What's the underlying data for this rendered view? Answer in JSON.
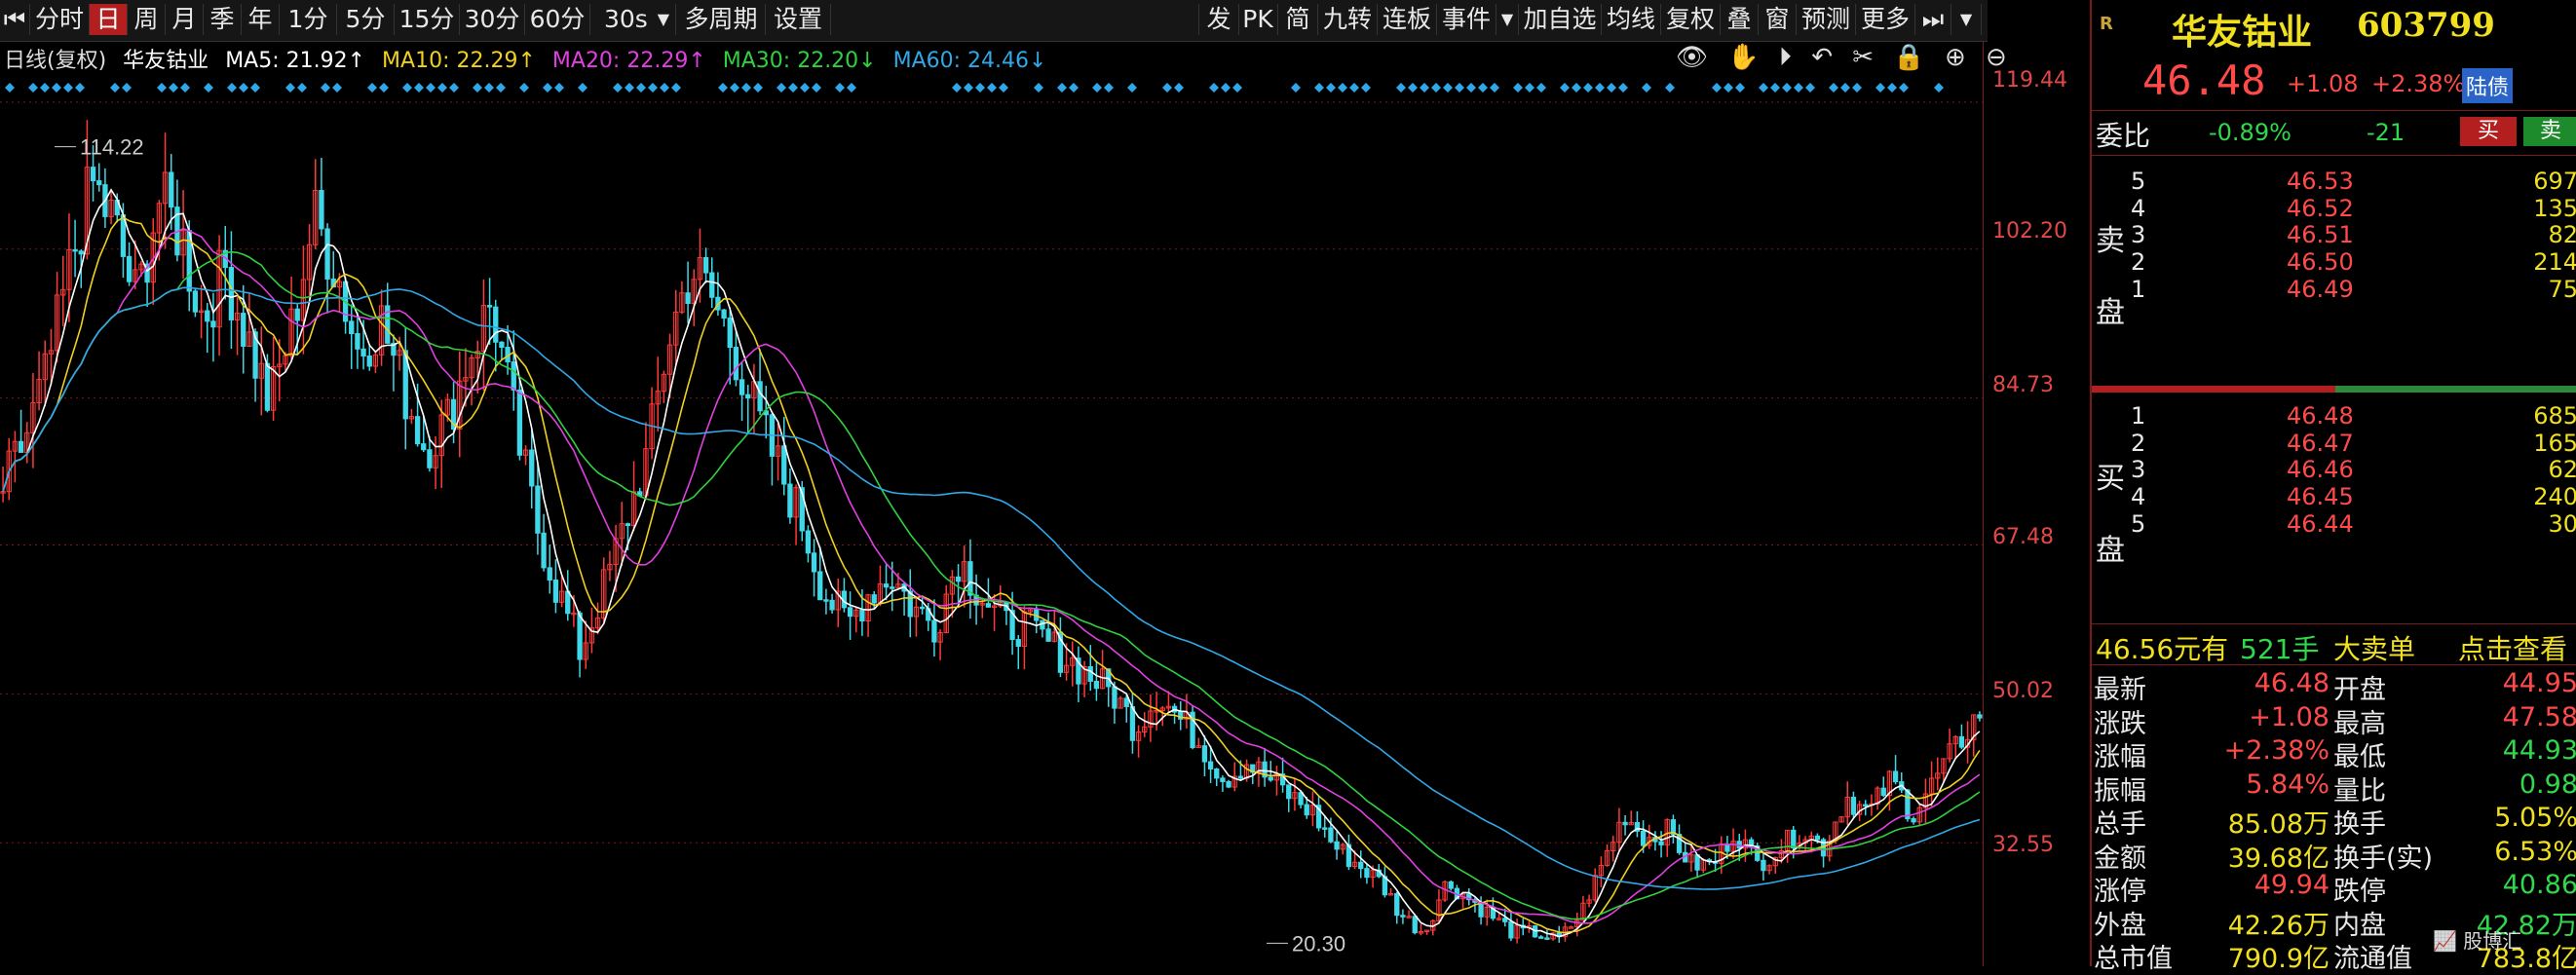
{
  "toolbar": {
    "left": [
      "分时",
      "日",
      "周",
      "月",
      "季",
      "年",
      "1分",
      "5分",
      "15分",
      "30分",
      "60分",
      "30s",
      "多周期",
      "设置"
    ],
    "right": [
      "发",
      "PK",
      "简",
      "九转",
      "连板",
      "事件",
      "加自选",
      "均线",
      "复权",
      "叠",
      "窗",
      "预测",
      "更多"
    ]
  },
  "ma": {
    "title": "日线(复权)",
    "name": "华友钴业",
    "ma5": "MA5: 21.92↑",
    "ma10": "MA10: 22.29↑",
    "ma20": "MA20: 22.29↑",
    "ma30": "MA30: 22.20↓",
    "ma60": "MA60: 24.46↓"
  },
  "axis": [
    "119.44",
    "102.20",
    "84.73",
    "67.48",
    "50.02",
    "32.55"
  ],
  "chart_data": {
    "type": "candlestick",
    "high_label": "114.22",
    "low_label": "20.30",
    "ylim": [
      20,
      120
    ],
    "close_series": [
      74,
      80,
      88,
      100,
      110,
      105,
      96,
      108,
      104,
      94,
      100,
      92,
      84,
      93,
      106,
      100,
      90,
      94,
      86,
      79,
      82,
      90,
      96,
      82,
      70,
      62,
      55,
      62,
      70,
      78,
      92,
      100,
      96,
      90,
      82,
      76,
      70,
      62,
      58,
      62,
      64,
      60,
      58,
      66,
      62,
      58,
      58,
      56,
      54,
      52,
      50,
      46,
      50,
      47,
      44,
      40,
      42,
      40,
      38,
      36,
      32,
      30,
      28,
      24,
      22,
      28,
      26,
      24,
      22,
      22,
      21,
      24,
      30,
      36,
      33,
      34,
      30,
      30,
      34,
      30,
      32,
      34,
      32,
      38,
      36,
      40,
      36,
      40,
      44,
      48
    ],
    "colors": {
      "up": "#ff3a3a",
      "down": "#3fd8e8",
      "ma5": "#ffffff",
      "ma10": "#f0d020",
      "ma20": "#e040e0",
      "ma30": "#30d040",
      "ma60": "#30a8e8"
    }
  },
  "panel": {
    "name": "华友钴业",
    "code": "603799",
    "price": "46.48",
    "change": "+1.08",
    "change_pct": "+2.38%",
    "tag": "陆债",
    "webi_label": "委比",
    "webi": "-0.89%",
    "weicha": "-21",
    "buy_btn": "买",
    "sell_btn": "卖",
    "sell_label1": "卖",
    "sell_label2": "盘",
    "buy_label1": "买",
    "buy_label2": "盘",
    "asks": [
      {
        "lvl": "5",
        "price": "46.53",
        "vol": "697"
      },
      {
        "lvl": "4",
        "price": "46.52",
        "vol": "135"
      },
      {
        "lvl": "3",
        "price": "46.51",
        "vol": "82"
      },
      {
        "lvl": "2",
        "price": "46.50",
        "vol": "214"
      },
      {
        "lvl": "1",
        "price": "46.49",
        "vol": "75"
      }
    ],
    "bids": [
      {
        "lvl": "1",
        "price": "46.48",
        "vol": "685"
      },
      {
        "lvl": "2",
        "price": "46.47",
        "vol": "165"
      },
      {
        "lvl": "3",
        "price": "46.46",
        "vol": "62"
      },
      {
        "lvl": "4",
        "price": "46.45",
        "vol": "240"
      },
      {
        "lvl": "5",
        "price": "46.44",
        "vol": "30"
      }
    ],
    "ticker": {
      "price": "46.56元有",
      "vol": "521手",
      "type": "大卖单",
      "action": "点击查看"
    },
    "stats": [
      {
        "l": "最新",
        "v": "46.48",
        "l2": "开盘",
        "v2": "44.95"
      },
      {
        "l": "涨跌",
        "v": "+1.08",
        "l2": "最高",
        "v2": "47.58"
      },
      {
        "l": "涨幅",
        "v": "+2.38%",
        "l2": "最低",
        "v2": "44.93"
      },
      {
        "l": "振幅",
        "v": "5.84%",
        "l2": "量比",
        "v2": "0.98"
      },
      {
        "l": "总手",
        "v": "85.08万",
        "l2": "换手",
        "v2": "5.05%"
      },
      {
        "l": "金额",
        "v": "39.68亿",
        "l2": "换手(实)",
        "v2": "6.53%"
      },
      {
        "l": "涨停",
        "v": "49.94",
        "l2": "跌停",
        "v2": "40.86"
      },
      {
        "l": "外盘",
        "v": "42.26万",
        "l2": "内盘",
        "v2": "42.82万"
      },
      {
        "l": "总市值",
        "v": "790.9亿",
        "l2": "流通值",
        "v2": "783.8亿"
      }
    ]
  }
}
